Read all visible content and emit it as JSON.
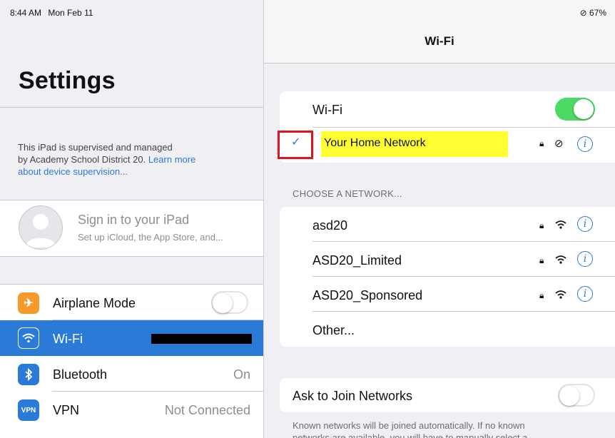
{
  "status": {
    "time": "8:44 AM",
    "date": "Mon Feb 11",
    "battery": "67%"
  },
  "settings": {
    "title": "Settings",
    "supervision": {
      "line1": "This iPad is supervised and managed",
      "line2": "by Academy School District 20.",
      "link1": "Learn more",
      "link2": "about device supervision..."
    },
    "signin": {
      "title": "Sign in to your iPad",
      "subtitle": "Set up iCloud, the App Store, and..."
    },
    "items": [
      {
        "label": "Airplane Mode",
        "icon": "airplane-icon",
        "color": "#f79a2d",
        "toggle": "off"
      },
      {
        "label": "Wi-Fi",
        "icon": "wifi-icon",
        "color": "#2a7ad8",
        "selected": true
      },
      {
        "label": "Bluetooth",
        "icon": "bluetooth-icon",
        "color": "#2a7ad8",
        "value": "On"
      },
      {
        "label": "VPN",
        "icon": "vpn-icon",
        "color": "#2a7ad8",
        "value": "Not Connected",
        "icon_text": "VPN"
      }
    ]
  },
  "wifi": {
    "title": "Wi-Fi",
    "toggle_label": "Wi-Fi",
    "connected": "Your Home Network",
    "choose_header": "CHOOSE A NETWORK...",
    "networks": [
      {
        "name": "asd20"
      },
      {
        "name": "ASD20_Limited"
      },
      {
        "name": "ASD20_Sponsored"
      }
    ],
    "other": "Other...",
    "ask_join": "Ask to Join Networks",
    "footer_line1": "Known networks will be joined automatically. If no known",
    "footer_line2": "networks are available, you will have to manually select a"
  },
  "colors": {
    "accent": "#2a7ad8",
    "toggle_on": "#4cd964",
    "highlight": "#ffff33",
    "annotation": "#e0121b"
  }
}
